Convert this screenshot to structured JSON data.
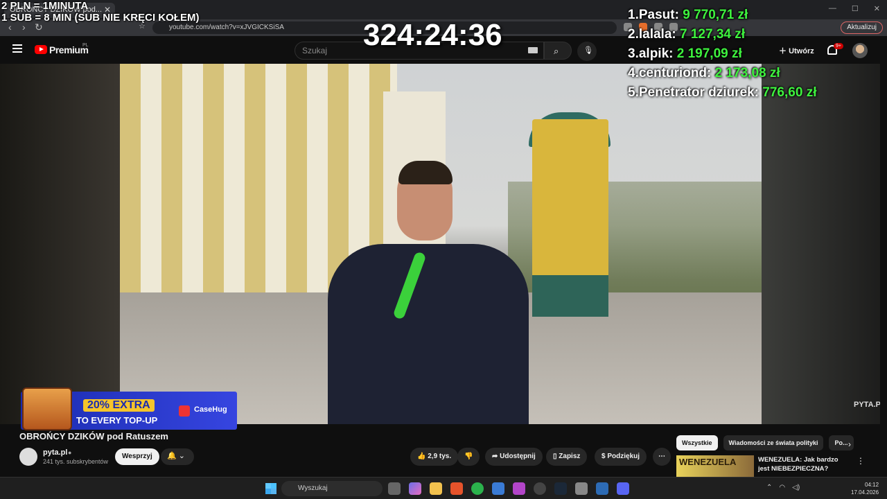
{
  "browser": {
    "tab_title": "OBROŃCY DZIKÓW pod...",
    "url": "youtube.com/watch?v=xJVGICKSiSA",
    "update_label": "Aktualizuj"
  },
  "youtube": {
    "brand": "Premium",
    "region": "PL",
    "search_placeholder": "Szukaj",
    "create_label": "Utwórz",
    "notifications_badge": "9+"
  },
  "overlay": {
    "line1": "2 PLN = 1MINUTA",
    "line2": "1 SUB = 8 MIN (SUB NIE KRĘCI KOŁEM)",
    "timer": "324:24:36",
    "leaderboard": [
      {
        "rank": "1.",
        "name": "Pasut:",
        "amount": "9 770,71 zł"
      },
      {
        "rank": "2.",
        "name": "lalala:",
        "amount": "7 127,34 zł"
      },
      {
        "rank": "3.",
        "name": "alpik:",
        "amount": "2 197,09 zł"
      },
      {
        "rank": "4.",
        "name": "centuriond:",
        "amount": "2 173,08 zł"
      },
      {
        "rank": "5.",
        "name": "Penetrator dziurek:",
        "amount": "776,60 zł"
      }
    ],
    "promo": {
      "line1": "20% EXTRA",
      "line2": "TO EVERY TOP-UP",
      "brand": "CaseHug"
    },
    "watermark": "PYTA.PL"
  },
  "video": {
    "title": "OBROŃCY DZIKÓW pod Ratuszem",
    "channel_name": "pyta.pl",
    "channel_subs": "241 tys. subskrybentów",
    "support_label": "Wesprzyj",
    "like_count": "2,9 tys.",
    "share_label": "Udostępnij",
    "save_label": "Zapisz",
    "thanks_label": "Podziękuj"
  },
  "sidebar": {
    "chips": [
      "Wszystkie",
      "Wiadomości ze świata polityki",
      "Po..."
    ],
    "recommended": {
      "thumb_text": "WENEZUELA",
      "title": "WENEZUELA: Jak bardzo jest NIEBEZPIECZNA?"
    }
  },
  "taskbar": {
    "search_placeholder": "Wyszukaj",
    "time": "04:12",
    "date": "17.04.2026"
  }
}
